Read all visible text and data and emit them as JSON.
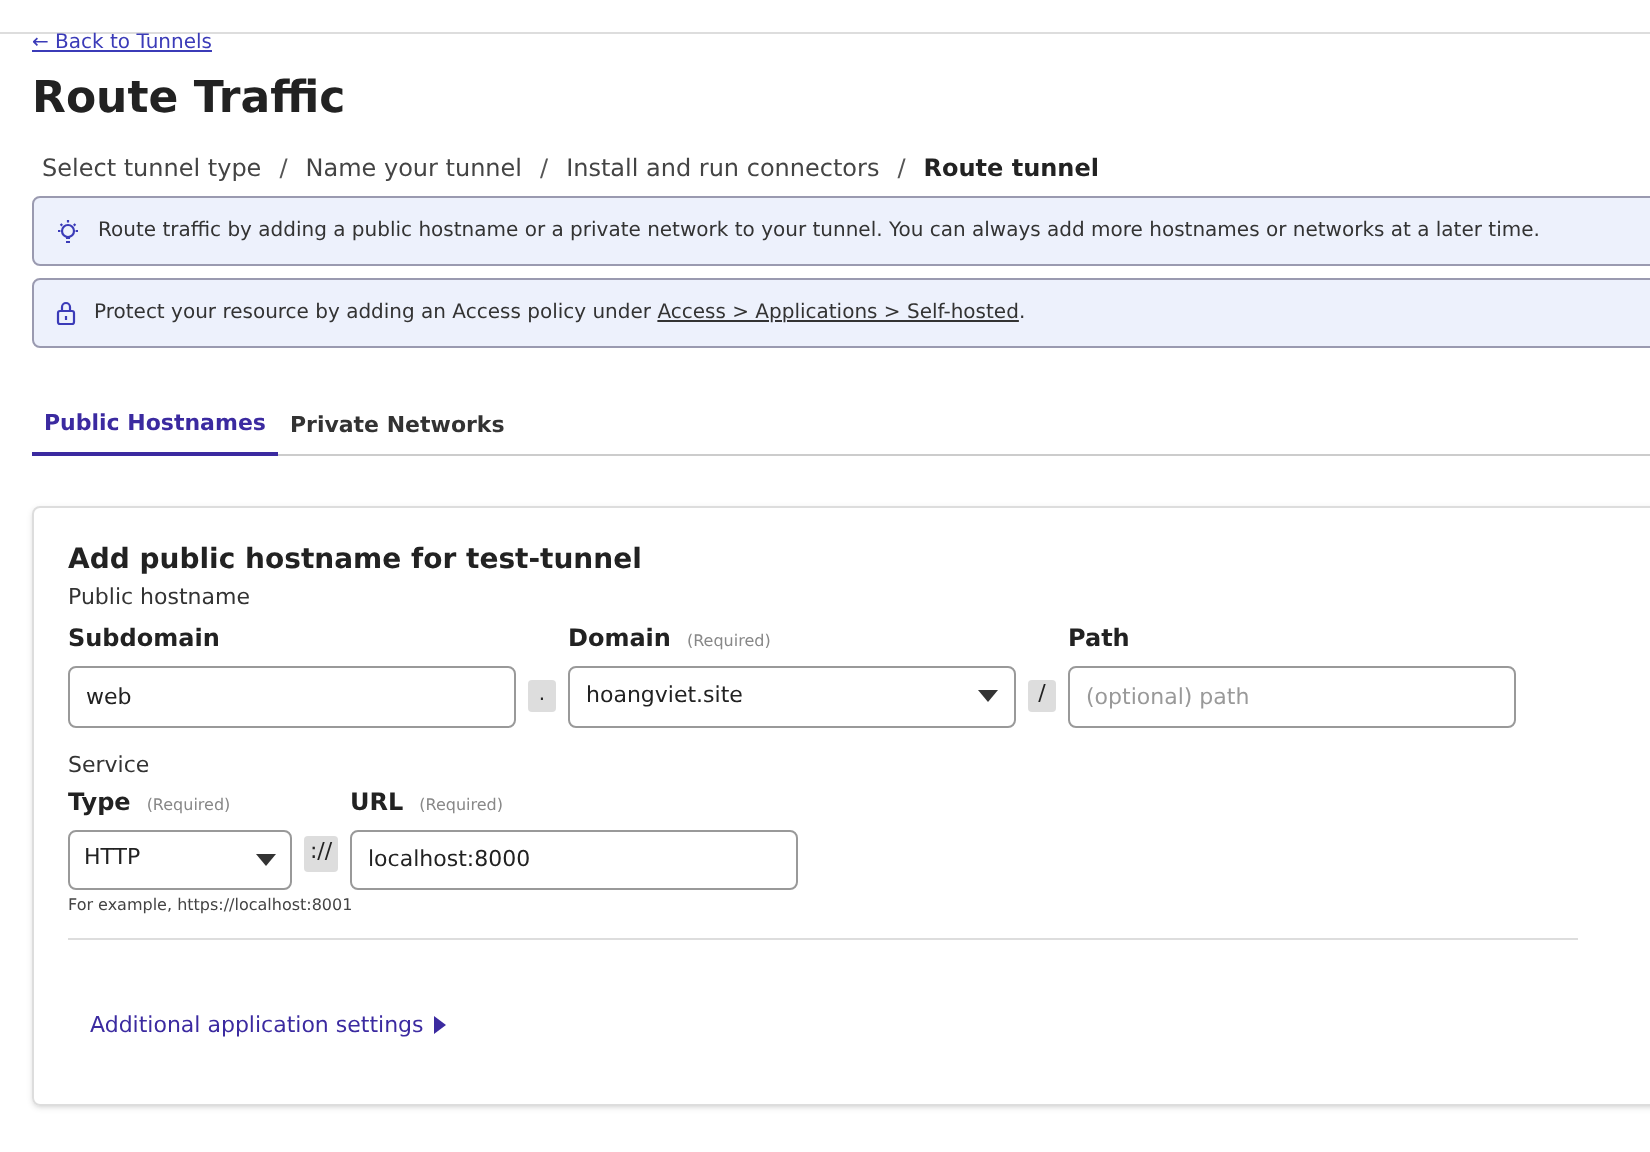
{
  "back_link": "← Back to Tunnels",
  "title": "Route Traffic",
  "breadcrumb": [
    {
      "label": "Select tunnel type",
      "selected": false
    },
    {
      "label": "Name your tunnel",
      "selected": false
    },
    {
      "label": "Install and run connectors",
      "selected": false
    },
    {
      "label": "Route tunnel",
      "selected": true
    }
  ],
  "breadcrumb_separator": "/",
  "notices": [
    {
      "kind": "tip",
      "text": "Route traffic by adding a public hostname or a private network to your tunnel. You can always add more hostnames or networks at a later time."
    },
    {
      "kind": "lock",
      "text": "Protect your resource by adding an Access policy under ",
      "link": "Access > Applications > Self-hosted",
      "after": "."
    }
  ],
  "tabs": [
    {
      "label": "Public Hostnames",
      "selected": true
    },
    {
      "label": "Private Networks",
      "selected": false
    }
  ],
  "form": {
    "heading": "Add public hostname for test-tunnel",
    "hostname_section": "Public hostname",
    "subdomain": {
      "label": "Subdomain",
      "value": "web"
    },
    "dot": ".",
    "domain": {
      "label": "Domain",
      "required": "(Required)",
      "value": "hoangviet.site"
    },
    "slash": "/",
    "path": {
      "label": "Path",
      "placeholder": "(optional) path"
    },
    "service_section": "Service",
    "type": {
      "label": "Type",
      "required": "(Required)",
      "value": "HTTP"
    },
    "scheme_sep": "://",
    "url": {
      "label": "URL",
      "required": "(Required)",
      "value": "localhost:8000"
    },
    "hint": "For example, https://localhost:8001",
    "additional": {
      "label": "Additional application settings",
      "expanded": false
    }
  }
}
